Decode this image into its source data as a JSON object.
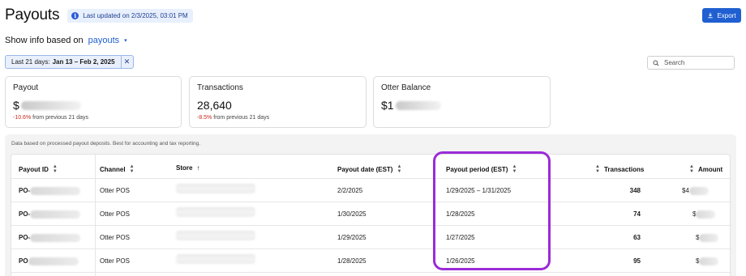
{
  "header": {
    "title": "Payouts",
    "updated": "Last updated on 2/3/2025, 03:01 PM",
    "export_label": "Export"
  },
  "filters": {
    "show_info_label": "Show info based on",
    "show_info_value": "payouts",
    "date_chip_label": "Last 21 days:",
    "date_chip_value": "Jan 13 – Feb 2, 2025",
    "search_placeholder": "Search"
  },
  "cards": [
    {
      "title": "Payout",
      "value_prefix": "$",
      "change": "-10.6%",
      "change_suffix": "from previous 21 days"
    },
    {
      "title": "Transactions",
      "value": "28,640",
      "change": "-8.5%",
      "change_suffix": "from previous 21 days"
    },
    {
      "title": "Otter Balance",
      "value_prefix": "$1"
    }
  ],
  "table": {
    "note": "Data based on processed payout deposits. Best for accounting and tax reporting.",
    "headers": {
      "payout_id": "Payout ID",
      "channel": "Channel",
      "store": "Store",
      "payout_date": "Payout date (EST)",
      "payout_period": "Payout period (EST)",
      "transactions": "Transactions",
      "amount": "Amount"
    },
    "rows": [
      {
        "id_prefix": "PO-",
        "channel": "Otter POS",
        "payout_date": "2/2/2025",
        "payout_period": "1/29/2025 – 1/31/2025",
        "transactions": "348",
        "amount_prefix": "$4"
      },
      {
        "id_prefix": "PO-",
        "channel": "Otter POS",
        "payout_date": "1/30/2025",
        "payout_period": "1/28/2025",
        "transactions": "74",
        "amount_prefix": "$"
      },
      {
        "id_prefix": "PO-",
        "channel": "Otter POS",
        "payout_date": "1/29/2025",
        "payout_period": "1/27/2025",
        "transactions": "63",
        "amount_prefix": "$"
      },
      {
        "id_prefix": "PO",
        "channel": "Otter POS",
        "payout_date": "1/28/2025",
        "payout_period": "1/26/2025",
        "transactions": "95",
        "amount_prefix": "$"
      }
    ]
  },
  "colors": {
    "accent": "#1f5fd1",
    "negative": "#c8281e",
    "highlight": "#9b2bd8"
  }
}
